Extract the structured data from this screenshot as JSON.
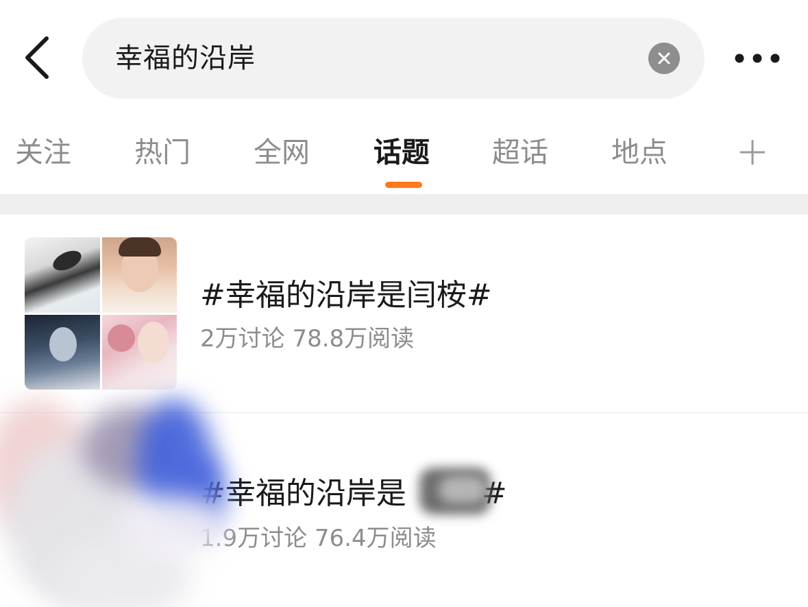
{
  "search": {
    "query": "幸福的沿岸"
  },
  "tabs": [
    {
      "label": "关注",
      "active": false
    },
    {
      "label": "热门",
      "active": false
    },
    {
      "label": "全网",
      "active": false
    },
    {
      "label": "话题",
      "active": true
    },
    {
      "label": "超话",
      "active": false
    },
    {
      "label": "地点",
      "active": false
    }
  ],
  "topics": [
    {
      "title": "#幸福的沿岸是闫桉#",
      "stats": "2万讨论 78.8万阅读"
    },
    {
      "title": "#幸福的沿岸是",
      "title_end": "#",
      "stats": "1.9万讨论 76.4万阅读"
    }
  ],
  "colors": {
    "accent": "#ff7a1a",
    "text_primary": "#1a1a1a",
    "text_secondary": "#8c8c8c",
    "search_bg": "#f2f2f2"
  },
  "icons": {
    "back": "chevron-left-icon",
    "clear": "close-circle-icon",
    "more": "more-dots-icon",
    "add": "plus-icon"
  }
}
